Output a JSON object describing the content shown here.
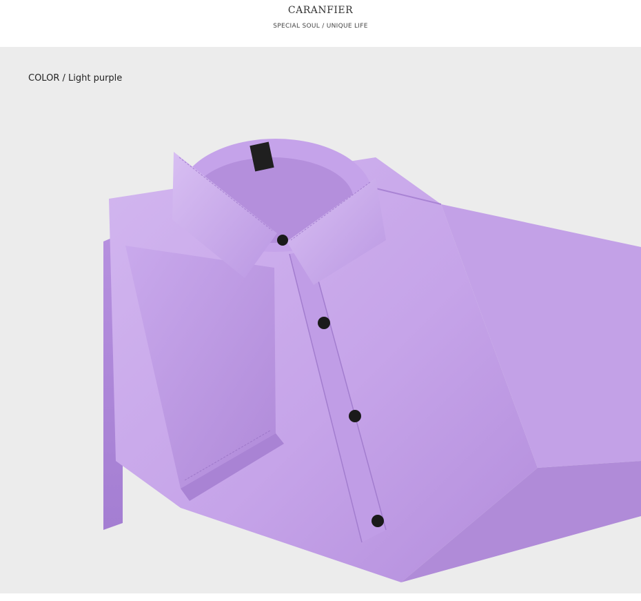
{
  "header": {
    "brand": "CARANFIER",
    "slogan": "SPECIAL SOUL / UNIQUE LIFE"
  },
  "product": {
    "color_label": "COLOR / Light purple",
    "shirt_color": "#c7a7e8",
    "button_color": "#1a1a1a",
    "background_color": "#ececec"
  }
}
